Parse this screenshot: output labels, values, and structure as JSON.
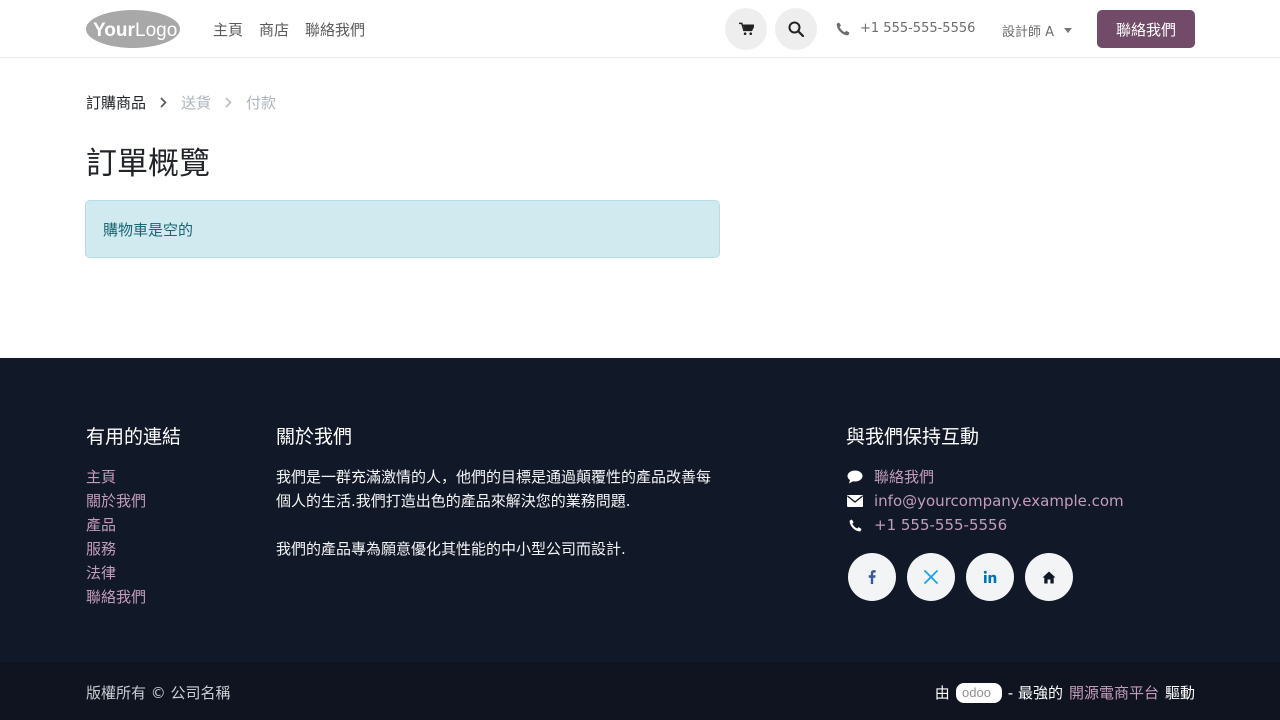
{
  "header": {
    "logo_text": "YourLogo",
    "nav": [
      "主頁",
      "商店",
      "聯絡我們"
    ],
    "phone": "+1 555-555-5556",
    "user": "設計師 A",
    "contact_button": "聯絡我們"
  },
  "breadcrumb": {
    "step1": "訂購商品",
    "step2": "送貨",
    "step3": "付款"
  },
  "main": {
    "title": "訂單概覽",
    "alert": "購物車是空的"
  },
  "footer": {
    "useful_links": {
      "heading": "有用的連結",
      "items": [
        "主頁",
        "關於我們",
        "產品",
        "服務",
        "法律",
        "聯絡我們"
      ]
    },
    "about": {
      "heading": "關於我們",
      "para1": "我們是一群充滿激情的人，他們的目標是通過顛覆性的產品改善每個人的生活.我們打造出色的產品來解決您的業務問題.",
      "para2": "我們的產品專為願意優化其性能的中小型公司而設計."
    },
    "connect": {
      "heading": "與我們保持互動",
      "contact": "聯絡我們",
      "email": "info@yourcompany.example.com",
      "phone": "+1 555-555-5556"
    },
    "copyright": "版權所有 © 公司名稱",
    "powered_prefix": "由",
    "odoo": "odoo",
    "powered_middle": "- 最強的",
    "powered_link": "開源電商平台",
    "powered_suffix": "驅動"
  },
  "colors": {
    "brand": "#714b67",
    "footer_bg": "#111827",
    "link": "#c39cbb",
    "alert_bg": "#d0eaef"
  },
  "icons": [
    "cart-icon",
    "search-icon",
    "phone-icon",
    "chevron-right-icon",
    "comment-icon",
    "envelope-icon",
    "facebook-icon",
    "x-icon",
    "linkedin-icon",
    "home-icon"
  ]
}
